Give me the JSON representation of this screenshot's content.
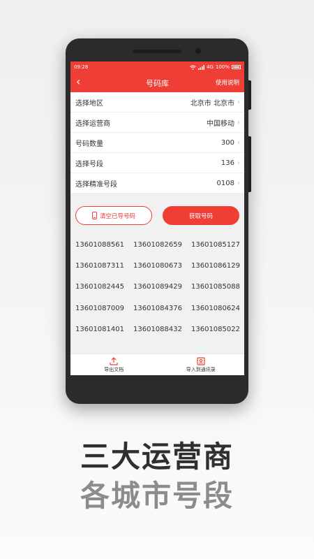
{
  "status_bar": {
    "time": "09:28",
    "network": "4G",
    "battery": "100%"
  },
  "nav": {
    "back_icon": "chevron-left-icon",
    "title": "号码库",
    "help": "使用说明"
  },
  "settings": [
    {
      "label": "选择地区",
      "value": "北京市  北京市"
    },
    {
      "label": "选择运营商",
      "value": "中国移动"
    },
    {
      "label": "号码数量",
      "value": "300"
    },
    {
      "label": "选择号段",
      "value": "136"
    },
    {
      "label": "选择精准号段",
      "value": "0108"
    }
  ],
  "actions": {
    "clear_label": "清空已导号码",
    "get_label": "获取号码"
  },
  "numbers": [
    [
      "13601088561",
      "13601082659",
      "13601085127"
    ],
    [
      "13601087311",
      "13601080673",
      "13601086129"
    ],
    [
      "13601082445",
      "13601089429",
      "13601085088"
    ],
    [
      "13601087009",
      "13601084376",
      "13601080624"
    ],
    [
      "13601081401",
      "13601088432",
      "13601085022"
    ]
  ],
  "bottom_tabs": {
    "export_label": "导出文档",
    "import_label": "导入到通讯录"
  },
  "promo": {
    "headline": "三大运营商",
    "subline": "各城市号段"
  },
  "colors": {
    "accent": "#ef3e36"
  }
}
